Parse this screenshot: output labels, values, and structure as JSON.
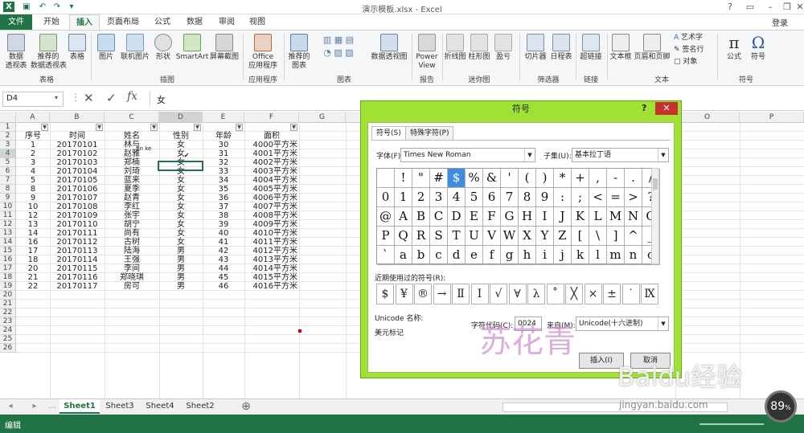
{
  "window": {
    "title": "演示模板.xlsx - Excel",
    "minimize": "–",
    "restore": "❐",
    "close": "✕",
    "help": "?"
  },
  "quick_access": [
    "save",
    "undo",
    "redo",
    "customize"
  ],
  "tabs": [
    "文件",
    "开始",
    "插入",
    "页面布局",
    "公式",
    "数据",
    "审阅",
    "视图"
  ],
  "login": "登录",
  "ribbon": {
    "buttons": [
      "数据\n透视表",
      "推荐的\n数据透视表",
      "表格",
      "图片",
      "联机图片",
      "形状",
      "SmartArt",
      "屏幕截图",
      "Office\n应用程序",
      "推荐的\n图表",
      "数据透视图",
      "Power\nView",
      "折线图",
      "柱形图",
      "盈亏",
      "切片器",
      "日程表",
      "超链接",
      "文本框",
      "页眉和页脚",
      "艺术字",
      "签名行",
      "对象",
      "公式",
      "符号"
    ],
    "groups": [
      "表格",
      "插图",
      "应用程序",
      "图表",
      "报告",
      "迷你图",
      "筛选器",
      "链接",
      "文本",
      "符号"
    ]
  },
  "formula_bar": {
    "name_box": "D4",
    "fx": "fx",
    "value": "女"
  },
  "columns": [
    "A",
    "B",
    "C",
    "D",
    "E",
    "F",
    "G",
    "O",
    "P"
  ],
  "headers": [
    "序号",
    "时间",
    "姓名",
    "性别",
    "年龄",
    "面积"
  ],
  "rows": [
    [
      "1",
      "20170101",
      "林与",
      "女",
      "30",
      "4000平方米"
    ],
    [
      "2",
      "20170102",
      "赵雅",
      "女",
      "31",
      "4001平方米"
    ],
    [
      "3",
      "20170103",
      "郑楠",
      "女",
      "32",
      "4002平方米"
    ],
    [
      "4",
      "20170104",
      "刘琦",
      "女",
      "33",
      "4003平方米"
    ],
    [
      "5",
      "20170105",
      "蓝来",
      "女",
      "34",
      "4004平方米"
    ],
    [
      "8",
      "20170106",
      "夏季",
      "女",
      "35",
      "4005平方米"
    ],
    [
      "9",
      "20170107",
      "赵青",
      "女",
      "36",
      "4006平方米"
    ],
    [
      "10",
      "20170108",
      "李红",
      "女",
      "37",
      "4007平方米"
    ],
    [
      "12",
      "20170109",
      "张宇",
      "女",
      "38",
      "4008平方米"
    ],
    [
      "13",
      "20170110",
      "胡宁",
      "女",
      "39",
      "4009平方米"
    ],
    [
      "14",
      "20170111",
      "尚有",
      "女",
      "40",
      "4010平方米"
    ],
    [
      "16",
      "20170112",
      "古树",
      "女",
      "41",
      "4011平方米"
    ],
    [
      "17",
      "20170113",
      "陆海",
      "男",
      "42",
      "4012平方米"
    ],
    [
      "18",
      "20170114",
      "王强",
      "男",
      "43",
      "4013平方米"
    ],
    [
      "20",
      "20170115",
      "李间",
      "男",
      "44",
      "4014平方米"
    ],
    [
      "21",
      "20170116",
      "郑晓琪",
      "男",
      "45",
      "4015平方米"
    ],
    [
      "22",
      "20170117",
      "房可",
      "男",
      "46",
      "4016平方米"
    ]
  ],
  "row_numbers": [
    "1",
    "2",
    "3",
    "4",
    "5",
    "6",
    "7",
    "8",
    "9",
    "10",
    "11",
    "12",
    "13",
    "14",
    "15",
    "16",
    "17",
    "18",
    "19",
    "20",
    "21",
    "22",
    "23",
    "24",
    "25",
    "26"
  ],
  "annotation": {
    "pinyin": "lin ke",
    "check": "✔"
  },
  "sheets": [
    "Sheet1",
    "Sheet3",
    "Sheet4",
    "Sheet2"
  ],
  "status": {
    "mode": "编辑",
    "zoom": "89"
  },
  "dialog": {
    "title": "符号",
    "tabs": [
      "符号(S)",
      "特殊字符(P)"
    ],
    "font_label": "字体(F):",
    "font_value": "Times New Roman",
    "subset_label": "子集(U):",
    "subset_value": "基本拉丁语",
    "symbols": [
      [
        "",
        "!",
        "\"",
        "#",
        "$",
        "%",
        "&",
        "'",
        "(",
        ")",
        "*",
        "+",
        ",",
        "-",
        ".",
        "/"
      ],
      [
        "0",
        "1",
        "2",
        "3",
        "4",
        "5",
        "6",
        "7",
        "8",
        "9",
        ":",
        ";",
        "<",
        "=",
        ">",
        "?"
      ],
      [
        "@",
        "A",
        "B",
        "C",
        "D",
        "E",
        "F",
        "G",
        "H",
        "I",
        "J",
        "K",
        "L",
        "M",
        "N",
        "O"
      ],
      [
        "P",
        "Q",
        "R",
        "S",
        "T",
        "U",
        "V",
        "W",
        "X",
        "Y",
        "Z",
        "[",
        "\\",
        "]",
        "^",
        "_"
      ],
      [
        "`",
        "a",
        "b",
        "c",
        "d",
        "e",
        "f",
        "g",
        "h",
        "i",
        "j",
        "k",
        "l",
        "m",
        "n",
        "o"
      ]
    ],
    "recent_label": "近期使用过的符号(R):",
    "recent": [
      "$",
      "¥",
      "®",
      "→",
      "Ⅱ",
      "Ⅰ",
      "√",
      "∀",
      "λ",
      "˚",
      "╳",
      "×",
      "±",
      "˙",
      "Ⅸ"
    ],
    "unicode_name_label": "Unicode 名称:",
    "unicode_name": "美元标记",
    "char_code_label": "字符代码(C):",
    "char_code": "0024",
    "from_label": "来自(M):",
    "from_value": "Unicode(十六进制)",
    "insert": "插入(I)",
    "cancel": "取消"
  },
  "watermark": {
    "brand": "苏花青",
    "site": "Baidu经验",
    "url": "jingyan.baidu.com"
  }
}
